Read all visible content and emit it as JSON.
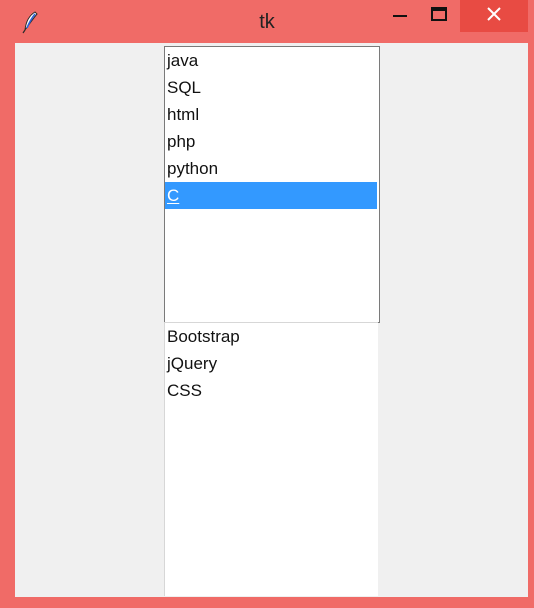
{
  "window": {
    "title": "tk",
    "app_icon": "feather-icon",
    "accent_color": "#f06b67",
    "close_color": "#e84b43",
    "controls": {
      "minimize_icon": "minimize-icon",
      "maximize_icon": "maximize-icon",
      "close_icon": "close-icon"
    }
  },
  "listboxes": [
    {
      "items": [
        {
          "label": "java"
        },
        {
          "label": "SQL"
        },
        {
          "label": "html"
        },
        {
          "label": "php"
        },
        {
          "label": "python"
        },
        {
          "label": "C",
          "selected": true
        }
      ],
      "selection_color": "#3399ff"
    },
    {
      "items": [
        {
          "label": "Bootstrap"
        },
        {
          "label": "jQuery"
        },
        {
          "label": "CSS"
        }
      ]
    }
  ]
}
